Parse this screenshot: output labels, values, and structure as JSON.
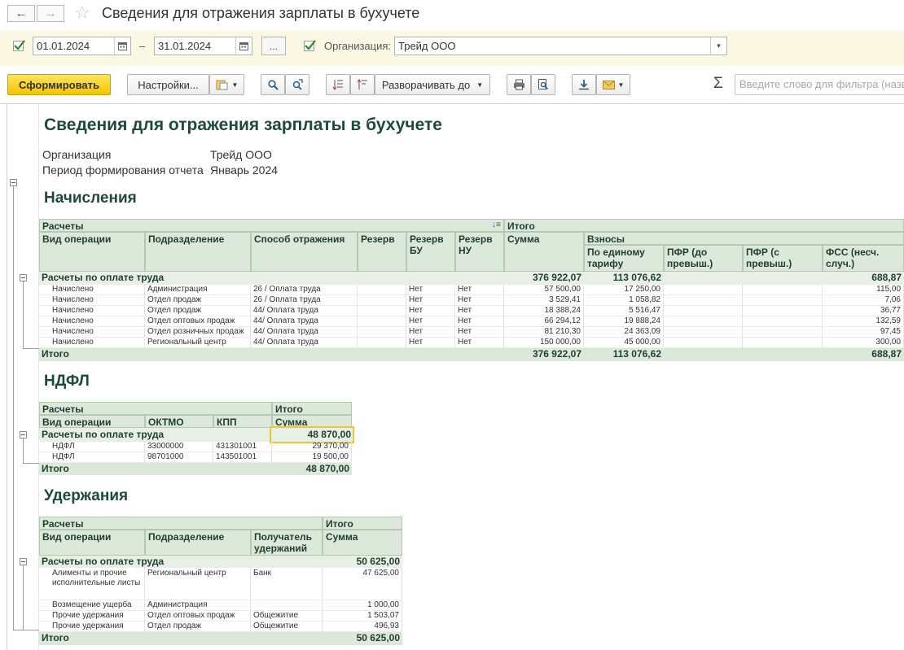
{
  "window": {
    "title": "Сведения для отражения зарплаты в бухучете"
  },
  "filters": {
    "date_from": "01.01.2024",
    "date_sep": "–",
    "date_to": "31.01.2024",
    "more_label": "...",
    "org_label": "Организация:",
    "org_value": "Трейд ООО"
  },
  "toolbar": {
    "generate_label": "Сформировать",
    "settings_label": "Настройки...",
    "expand_label": "Разворачивать до",
    "sigma": "Σ",
    "search_placeholder": "Введите слово для фильтра (назва"
  },
  "report": {
    "title": "Сведения для отражения зарплаты в бухучете",
    "params": [
      {
        "label": "Организация",
        "value": "Трейд ООО"
      },
      {
        "label": "Период формирования отчета",
        "value": "Январь 2024"
      }
    ],
    "accruals": {
      "title": "Начисления",
      "h_calc": "Расчеты",
      "h_total": "Итого",
      "h_op": "Вид операции",
      "h_dept": "Подразделение",
      "h_method": "Способ отражения",
      "h_res": "Резерв",
      "h_res_bu": "Резерв БУ",
      "h_res_nu": "Резерв НУ",
      "h_sum": "Сумма",
      "h_contrib": "Взносы",
      "h_single": "По единому тарифу",
      "h_pfr1": "ПФР (до превыш.)",
      "h_pfr2": "ПФР (с превыш.)",
      "h_fss": "ФСС (несч. случ.)",
      "group": {
        "label": "Расчеты по оплате труда",
        "sum": "376 922,07",
        "single": "113 076,62",
        "fss": "688,87"
      },
      "rows": [
        {
          "op": "Начислено",
          "dept": "Администрация",
          "method": "26 / Оплата труда",
          "bu": "Нет",
          "nu": "Нет",
          "sum": "57 500,00",
          "single": "17 250,00",
          "fss": "115,00"
        },
        {
          "op": "Начислено",
          "dept": "Отдел продаж",
          "method": "26 / Оплата труда",
          "bu": "Нет",
          "nu": "Нет",
          "sum": "3 529,41",
          "single": "1 058,82",
          "fss": "7,06"
        },
        {
          "op": "Начислено",
          "dept": "Отдел продаж",
          "method": "44/ Оплата труда",
          "bu": "Нет",
          "nu": "Нет",
          "sum": "18 388,24",
          "single": "5 516,47",
          "fss": "36,77"
        },
        {
          "op": "Начислено",
          "dept": "Отдел оптовых продаж",
          "method": "44/ Оплата труда",
          "bu": "Нет",
          "nu": "Нет",
          "sum": "66 294,12",
          "single": "19 888,24",
          "fss": "132,59"
        },
        {
          "op": "Начислено",
          "dept": "Отдел розничных продаж",
          "method": "44/ Оплата труда",
          "bu": "Нет",
          "nu": "Нет",
          "sum": "81 210,30",
          "single": "24 363,09",
          "fss": "97,45"
        },
        {
          "op": "Начислено",
          "dept": "Региональный центр",
          "method": "44/ Оплата труда",
          "bu": "Нет",
          "nu": "Нет",
          "sum": "150 000,00",
          "single": "45 000,00",
          "fss": "300,00"
        }
      ],
      "total": {
        "label": "Итого",
        "sum": "376 922,07",
        "single": "113 076,62",
        "fss": "688,87"
      }
    },
    "ndfl": {
      "title": "НДФЛ",
      "h_calc": "Расчеты",
      "h_total": "Итого",
      "h_op": "Вид операции",
      "h_oktmo": "ОКТМО",
      "h_kpp": "КПП",
      "h_sum": "Сумма",
      "group": {
        "label": "Расчеты по оплате труда",
        "sum": "48 870,00"
      },
      "rows": [
        {
          "op": "НДФЛ",
          "oktmo": "33000000",
          "kpp": "431301001",
          "sum": "29 370,00"
        },
        {
          "op": "НДФЛ",
          "oktmo": "98701000",
          "kpp": "143501001",
          "sum": "19 500,00"
        }
      ],
      "total": {
        "label": "Итого",
        "sum": "48 870,00"
      }
    },
    "deductions": {
      "title": "Удержания",
      "h_calc": "Расчеты",
      "h_total": "Итого",
      "h_op": "Вид операции",
      "h_dept": "Подразделение",
      "h_recipient": "Получатель удержаний",
      "h_sum": "Сумма",
      "group": {
        "label": "Расчеты по оплате труда",
        "sum": "50 625,00"
      },
      "rows": [
        {
          "op": "Алименты и прочие исполнительные листы",
          "dept": "Региональный центр",
          "recipient": "Банк",
          "sum": "47 625,00"
        },
        {
          "op": "Возмещение ущерба",
          "dept": "Администрация",
          "recipient": "",
          "sum": "1 000,00"
        },
        {
          "op": "Прочие удержания",
          "dept": "Отдел оптовых продаж",
          "recipient": "Общежитие",
          "sum": "1 503,07"
        },
        {
          "op": "Прочие удержания",
          "dept": "Отдел продаж",
          "recipient": "Общежитие",
          "sum": "496,93"
        }
      ],
      "total": {
        "label": "Итого",
        "sum": "50 625,00"
      }
    }
  }
}
